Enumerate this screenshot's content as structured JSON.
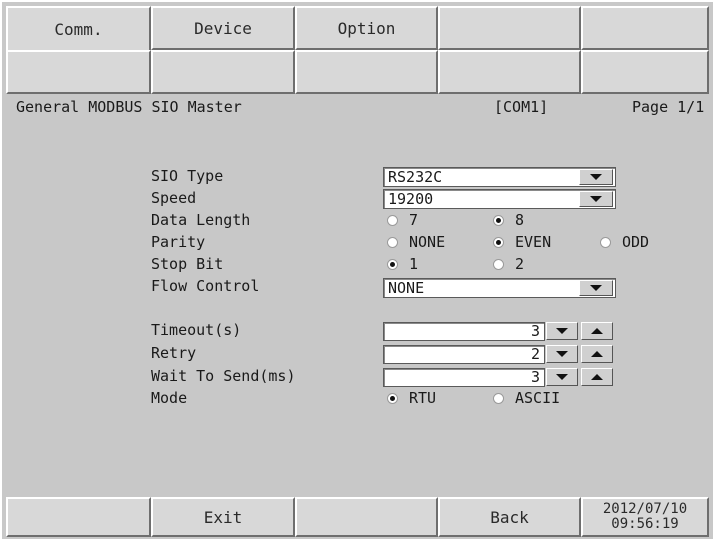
{
  "tabs_row1": [
    "Comm.",
    "Device",
    "Option",
    "",
    ""
  ],
  "tabs_row2": [
    "",
    "",
    "",
    "",
    ""
  ],
  "header": {
    "title": "General MODBUS SIO Master",
    "port": "[COM1]",
    "page": "Page 1/1"
  },
  "labels": {
    "sio_type": "SIO Type",
    "speed": "Speed",
    "data_length": "Data Length",
    "parity": "Parity",
    "stop_bit": "Stop Bit",
    "flow_control": "Flow Control",
    "timeout": "Timeout(s)",
    "retry": "Retry",
    "wait_to_send": "Wait To Send(ms)",
    "mode": "Mode"
  },
  "fields": {
    "sio_type": "RS232C",
    "speed": "19200",
    "flow_control": "NONE",
    "timeout": "3",
    "retry": "2",
    "wait_to_send": "3"
  },
  "options": {
    "data_length": [
      {
        "label": "7",
        "selected": false
      },
      {
        "label": "8",
        "selected": true
      }
    ],
    "parity": [
      {
        "label": "NONE",
        "selected": false
      },
      {
        "label": "EVEN",
        "selected": true
      },
      {
        "label": "ODD",
        "selected": false
      }
    ],
    "stop_bit": [
      {
        "label": "1",
        "selected": true
      },
      {
        "label": "2",
        "selected": false
      }
    ],
    "mode": [
      {
        "label": "RTU",
        "selected": true
      },
      {
        "label": "ASCII",
        "selected": false
      }
    ]
  },
  "footer": {
    "exit": "Exit",
    "back": "Back",
    "date": "2012/07/10",
    "time": "09:56:19"
  }
}
